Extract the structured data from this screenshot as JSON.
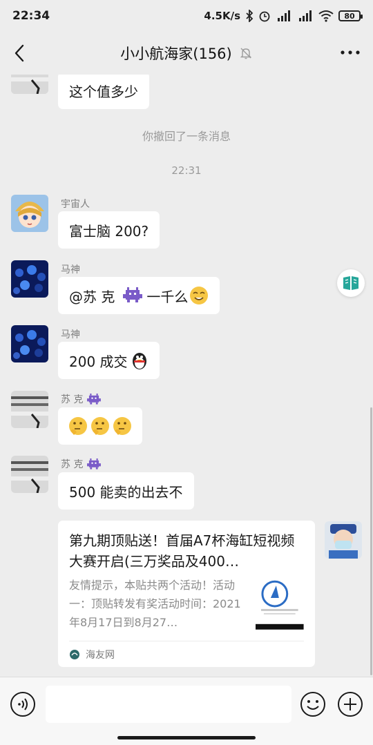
{
  "status": {
    "time": "22:34",
    "speed": "4.5K/s",
    "battery": "80"
  },
  "nav": {
    "title": "小小航海家(156)"
  },
  "messages": {
    "m1_text": "这个值多少",
    "recall_notice": "你撤回了一条消息",
    "timestamp": "22:31",
    "m2_sender": "宇宙人",
    "m2_text": "富士脑 200?",
    "m3_sender": "马神",
    "m3_text_a": "@苏 克",
    "m3_text_b": "一千么",
    "m4_sender": "马神",
    "m4_text": "200 成交",
    "m5_sender": "苏 克",
    "m6_sender": "苏 克",
    "m6_text": "500 能卖的出去不"
  },
  "card": {
    "title": "第九期顶贴送！首届A7杯海缸短视频大赛开启(三万奖品及400…",
    "desc": "友情提示，本贴共两个活动！活动一：顶贴转发有奖活动时间：2021年8月17日到8月27…",
    "source": "海友网"
  },
  "colors": {
    "background": "#ededed",
    "bubble": "#ffffff",
    "float_button_icon": "#26a69a"
  },
  "icons": {
    "back": "chevron-left-icon",
    "mute": "bell-off-icon",
    "more": "more-icon",
    "voice": "voice-icon",
    "emoji": "smiley-icon",
    "add": "plus-icon"
  }
}
